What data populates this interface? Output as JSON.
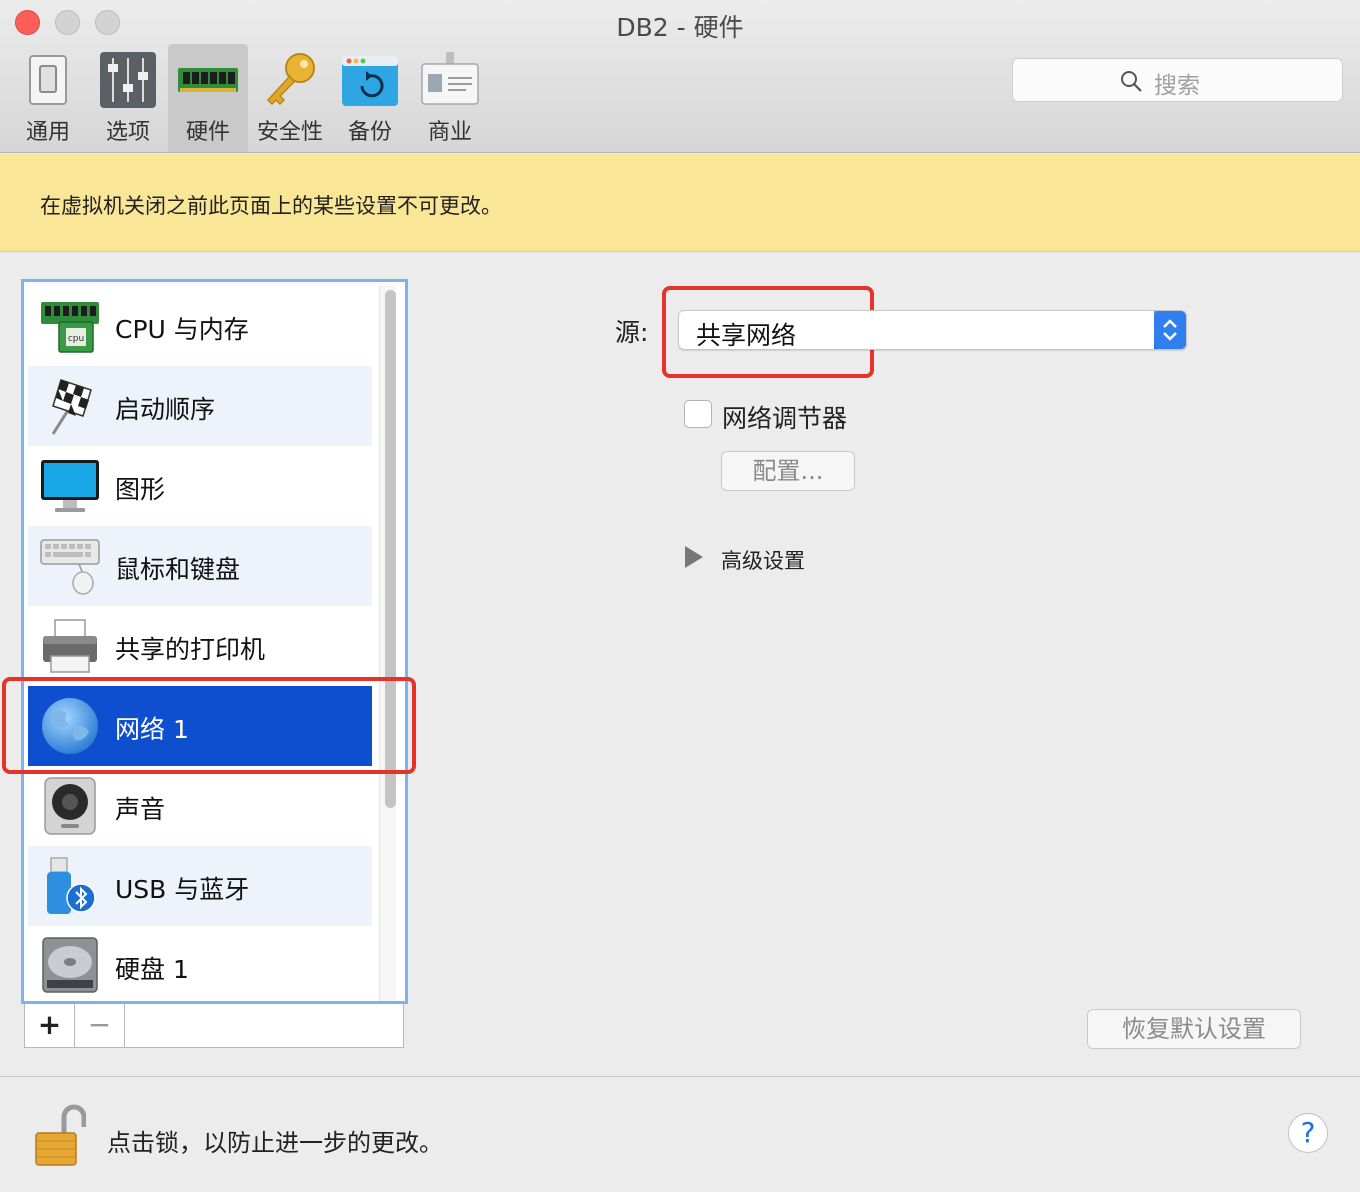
{
  "window": {
    "title": "DB2 - 硬件"
  },
  "toolbar": {
    "items": [
      {
        "label": "通用",
        "icon": "switch-icon"
      },
      {
        "label": "选项",
        "icon": "sliders-icon"
      },
      {
        "label": "硬件",
        "icon": "memory-chip-icon",
        "active": true
      },
      {
        "label": "安全性",
        "icon": "key-icon"
      },
      {
        "label": "备份",
        "icon": "backup-icon"
      },
      {
        "label": "商业",
        "icon": "badge-icon"
      }
    ]
  },
  "search": {
    "placeholder": "搜索"
  },
  "banner": {
    "text": "在虚拟机关闭之前此页面上的某些设置不可更改。"
  },
  "device_list": {
    "items": [
      {
        "label": "CPU 与内存",
        "icon": "cpu-memory-icon"
      },
      {
        "label": "启动顺序",
        "icon": "checkered-flag-icon"
      },
      {
        "label": "图形",
        "icon": "monitor-icon"
      },
      {
        "label": "鼠标和键盘",
        "icon": "keyboard-mouse-icon"
      },
      {
        "label": "共享的打印机",
        "icon": "printer-icon"
      },
      {
        "label": "网络 1",
        "icon": "globe-icon",
        "selected": true
      },
      {
        "label": "声音",
        "icon": "speaker-icon"
      },
      {
        "label": "USB 与蓝牙",
        "icon": "usb-bluetooth-icon"
      },
      {
        "label": "硬盘 1",
        "icon": "hard-disk-icon"
      }
    ],
    "add_label": "+",
    "remove_label": "−"
  },
  "network": {
    "source_label": "源:",
    "source_value": "共享网络",
    "conditioner_label": "网络调节器",
    "conditioner_checked": false,
    "config_button": "配置...",
    "advanced_label": "高级设置",
    "restore_button": "恢复默认设置"
  },
  "footer": {
    "lock_text": "点击锁，以防止进一步的更改。",
    "help_label": "?"
  },
  "colors": {
    "banner": "#f9e697",
    "selection": "#0e4fd0",
    "highlight": "#e5332a",
    "close_button": "#fc5f57"
  }
}
